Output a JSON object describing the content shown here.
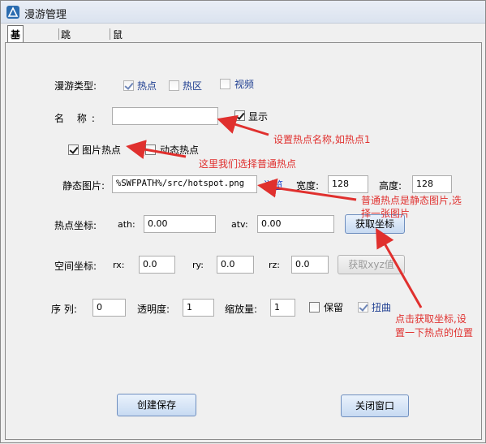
{
  "window": {
    "title": "漫游管理"
  },
  "tabs": [
    "基本属性",
    "跳转场景",
    "鼠标事件"
  ],
  "roam_type": {
    "label": "漫游类型:",
    "options": [
      {
        "label": "热点",
        "checked": true
      },
      {
        "label": "热区",
        "checked": false
      },
      {
        "label": "视频",
        "checked": false
      }
    ]
  },
  "name": {
    "label": "名  称:",
    "value": "",
    "show_label": "显示",
    "show_checked": true
  },
  "hotspot_kind": {
    "image": {
      "label": "图片热点",
      "checked": true
    },
    "animated": {
      "label": "动态热点",
      "checked": false
    }
  },
  "static_image": {
    "label": "静态图片:",
    "value": "%SWFPATH%/src/hotspot.png",
    "browse": "浏览",
    "width_label": "宽度:",
    "width": "128",
    "height_label": "高度:",
    "height": "128"
  },
  "hotspot_coords": {
    "label": "热点坐标:",
    "ath_label": "ath:",
    "ath": "0.00",
    "atv_label": "atv:",
    "atv": "0.00",
    "button": "获取坐标"
  },
  "space_coords": {
    "label": "空间坐标:",
    "rx_label": "rx:",
    "rx": "0.0",
    "ry_label": "ry:",
    "ry": "0.0",
    "rz_label": "rz:",
    "rz": "0.0",
    "button": "获取xyz值"
  },
  "misc": {
    "order_label": "序 列:",
    "order": "0",
    "opacity_label": "透明度:",
    "opacity": "1",
    "scale_label": "缩放量:",
    "scale": "1",
    "keep_label": "保留",
    "keep_checked": false,
    "distort_label": "扭曲",
    "distort_checked": true
  },
  "buttons": {
    "save": "创建保存",
    "close": "关闭窗口"
  },
  "annotations": {
    "name_tip": "设置热点名称,如热点1",
    "hotspot_tip": "这里我们选择普通热点",
    "static_tip_1": "普通热点是静态图片,选",
    "static_tip_2": "择一张图片",
    "coords_tip_1": "点击获取坐标,设",
    "coords_tip_2": "置一下热点的位置"
  },
  "colors": {
    "annotation": "#e0302e",
    "link": "#0a37c9",
    "label_blue": "#1e3e91"
  }
}
